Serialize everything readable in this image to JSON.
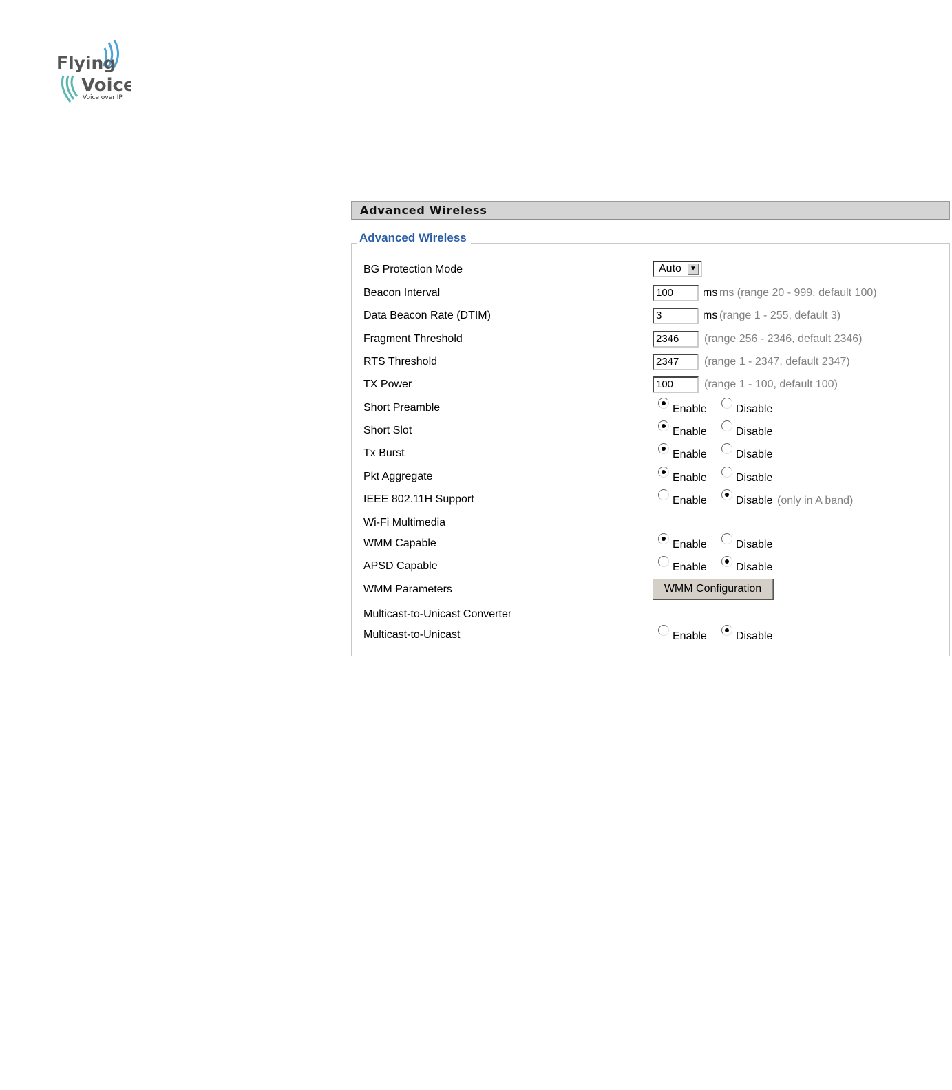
{
  "logo": {
    "line1": "Flying",
    "line2": "Voice",
    "tagline": "Voice over IP"
  },
  "panel": {
    "title": "Advanced Wireless"
  },
  "section": {
    "legend": "Advanced Wireless"
  },
  "fields": {
    "bg_protection": {
      "label": "BG Protection Mode",
      "value": "Auto"
    },
    "beacon_interval": {
      "label": "Beacon Interval",
      "value": "100",
      "unit": "ms",
      "hint": "ms (range 20 - 999, default 100)"
    },
    "dtim": {
      "label": "Data Beacon Rate (DTIM)",
      "value": "3",
      "unit": "ms",
      "hint": "(range 1 - 255, default 3)"
    },
    "fragment": {
      "label": "Fragment Threshold",
      "value": "2346",
      "hint": "(range 256 - 2346, default 2346)"
    },
    "rts": {
      "label": "RTS Threshold",
      "value": "2347",
      "hint": "(range 1 - 2347, default 2347)"
    },
    "tx_power": {
      "label": "TX Power",
      "value": "100",
      "hint": "(range 1 - 100, default 100)"
    },
    "short_preamble": {
      "label": "Short Preamble",
      "selected": "Enable"
    },
    "short_slot": {
      "label": "Short Slot",
      "selected": "Enable"
    },
    "tx_burst": {
      "label": "Tx Burst",
      "selected": "Enable"
    },
    "pkt_aggregate": {
      "label": "Pkt Aggregate",
      "selected": "Enable"
    },
    "ieee_80211h": {
      "label": "IEEE 802.11H Support",
      "selected": "Disable",
      "hint": "(only in A band)"
    },
    "wifi_multimedia": {
      "label": "Wi-Fi Multimedia"
    },
    "wmm_capable": {
      "label": "WMM Capable",
      "selected": "Enable"
    },
    "apsd_capable": {
      "label": "APSD Capable",
      "selected": "Disable"
    },
    "wmm_parameters": {
      "label": "WMM Parameters",
      "button": "WMM Configuration"
    },
    "m2u_converter": {
      "label": "Multicast-to-Unicast Converter"
    },
    "m2u": {
      "label": "Multicast-to-Unicast",
      "selected": "Disable"
    }
  },
  "radio_labels": {
    "enable": "Enable",
    "disable": "Disable"
  }
}
